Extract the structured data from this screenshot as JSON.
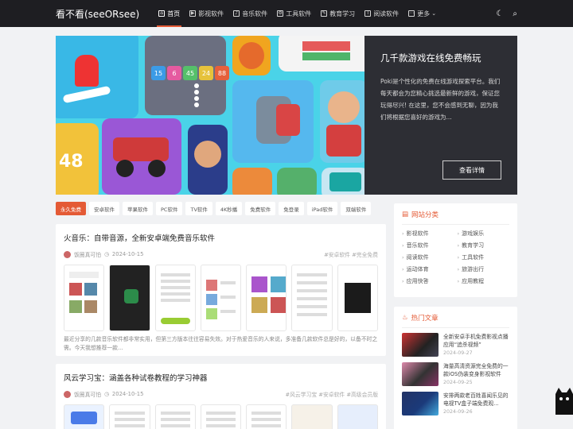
{
  "header": {
    "logo": "看不看(seeORsee)",
    "nav": [
      {
        "label": "首页",
        "icon": "home-icon",
        "glyph": "⌂"
      },
      {
        "label": "影视软件",
        "icon": "film-icon",
        "glyph": "▶"
      },
      {
        "label": "音乐软件",
        "icon": "music-icon",
        "glyph": "♪"
      },
      {
        "label": "工具软件",
        "icon": "gear-icon",
        "glyph": "⚙"
      },
      {
        "label": "教育学习",
        "icon": "pencil-icon",
        "glyph": "✎"
      },
      {
        "label": "阅读软件",
        "icon": "book-icon",
        "glyph": "T"
      },
      {
        "label": "更多",
        "icon": "more-icon",
        "glyph": "⋯"
      }
    ]
  },
  "hero": {
    "title": "几千款游戏在线免费畅玩",
    "description": "Poki是个性化的免费在线游戏探索平台。我们每天都会为您精心挑选最新鲜的游戏，保证您玩得尽兴! 在这里，您不会感到无聊，因为我们将根据您喜好的游戏为...",
    "button": "查看详情",
    "game_numbers": [
      "15",
      "6",
      "45",
      "24",
      "88"
    ],
    "side_number": "48"
  },
  "tabs": [
    "永久免费",
    "安卓软件",
    "苹果软件",
    "PC软件",
    "TV软件",
    "4K秒播",
    "免费软件",
    "免登录",
    "iPad软件",
    "双端软件"
  ],
  "articles": [
    {
      "title": "火音乐：自带音源，全新安卓端免费音乐软件",
      "author": "饭圈真可怕",
      "date": "2024-10-15",
      "tags": "#安卓软件 #完全免费",
      "excerpt": "最近分享的几款音乐软件都非常实用，但第三方版本往往容易失效。对于热爱音乐的人来说，多准备几款软件总是好的，以备不时之需。今天我想推荐一款..."
    },
    {
      "title": "风云学习宝：涵盖各种试卷教程的学习神器",
      "author": "饭圈真可怕",
      "date": "2024-10-15",
      "tags": "#风云学习宝 #安卓软件 #高级会员版"
    }
  ],
  "sidebar": {
    "categories_title": "网站分类",
    "categories": [
      "影视软件",
      "游戏娱乐",
      "音乐软件",
      "教育学习",
      "阅读软件",
      "工具软件",
      "运动体育",
      "旅游出行",
      "应用快答",
      "应用教程"
    ],
    "hot_title": "热门文章",
    "hot": [
      {
        "title": "全新安卓手机免费影视点播应用“追杀视频”",
        "date": "2024-09-27"
      },
      {
        "title": "海量高清资源完全免费的一款iOS伪装变身影视软件",
        "date": "2024-09-25"
      },
      {
        "title": "安排两款老百姓喜闻乐见的电视TV盒子端免费观...",
        "date": "2024-09-26"
      }
    ]
  },
  "colors": {
    "accent": "#e45a35",
    "header_bg": "#1e1e22",
    "hero_panel": "#2d2e34"
  }
}
